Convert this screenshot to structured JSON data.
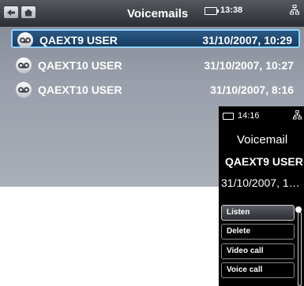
{
  "main": {
    "title": "Voicemails",
    "clock": "13:38",
    "messages": [
      {
        "name": "QAEXT9 USER",
        "date": "31/10/2007, 10:29",
        "selected": true
      },
      {
        "name": "QAEXT10 USER",
        "date": "31/10/2007, 10:27",
        "selected": false
      },
      {
        "name": "QAEXT10 USER",
        "date": "31/10/2007, 8:16",
        "selected": false
      }
    ]
  },
  "popup": {
    "clock": "14:16",
    "title": "Voicemail",
    "name": "QAEXT9 USER",
    "date": "31/10/2007, 1…",
    "menu": [
      "Listen",
      "Delete",
      "Video call",
      "Voice call"
    ]
  },
  "colors": {
    "selection": "#1f4a74",
    "selection_border": "#8fd3ff"
  }
}
